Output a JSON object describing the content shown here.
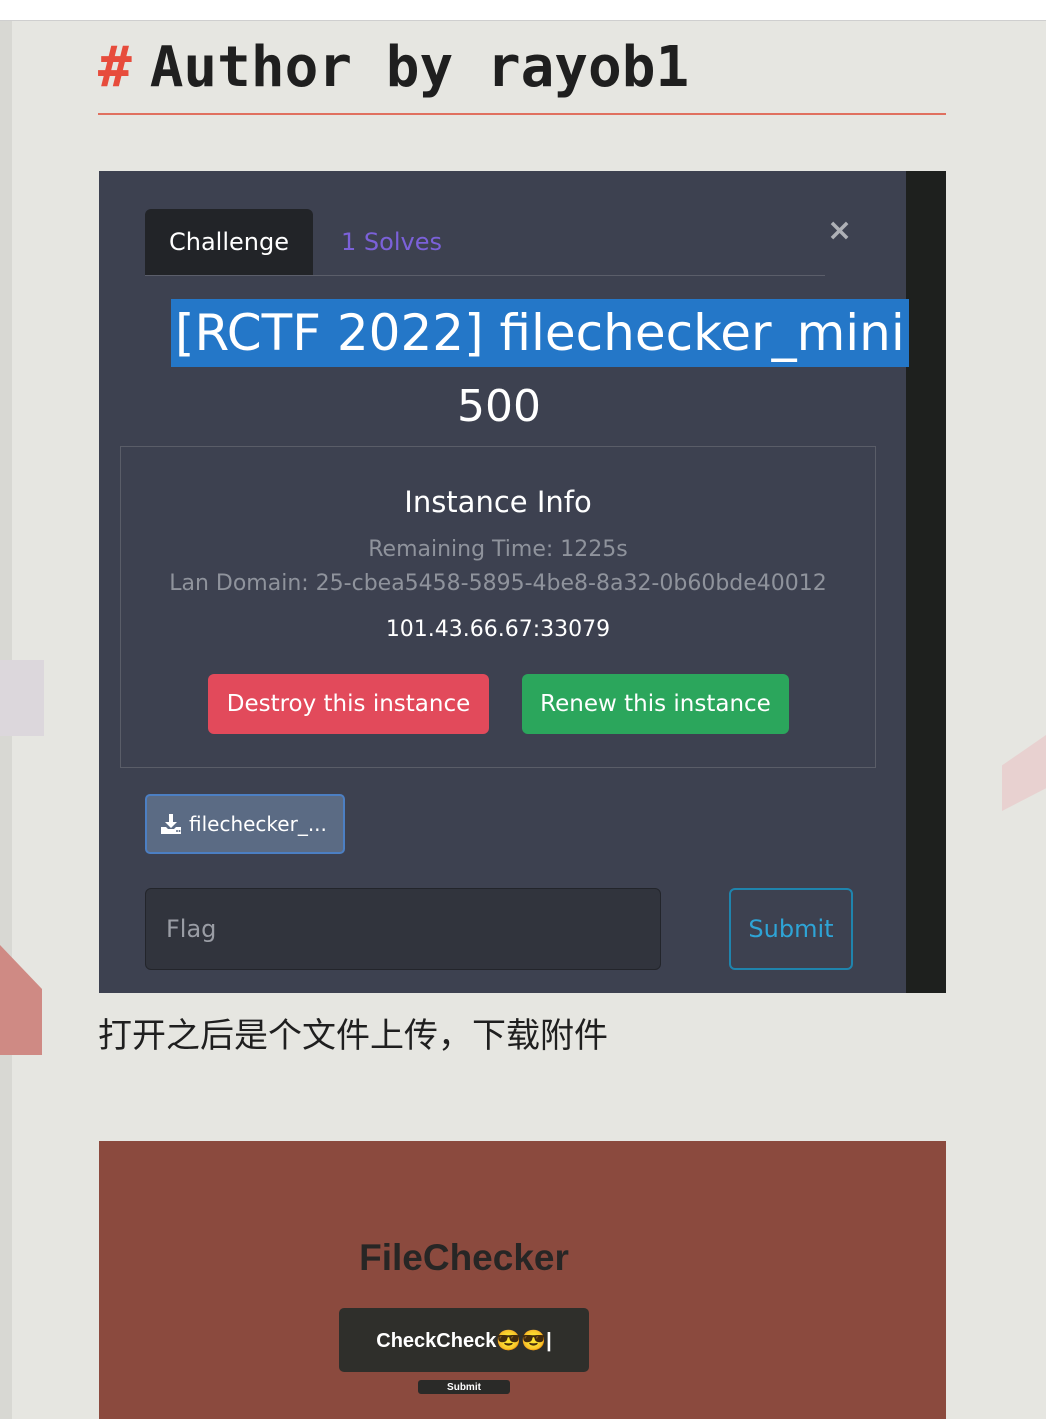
{
  "heading": {
    "hash": "#",
    "text": "Author by rayob1"
  },
  "challenge_modal": {
    "tabs": {
      "challenge": "Challenge",
      "solves": "1 Solves"
    },
    "close_symbol": "×",
    "title": "[RCTF 2022] filechecker_mini",
    "points": "500",
    "instance": {
      "title": "Instance Info",
      "remaining": "Remaining Time: 1225s",
      "lan_domain": "Lan Domain: 25-cbea5458-5895-4be8-8a32-0b60bde40012",
      "address": "101.43.66.67:33079",
      "destroy_label": "Destroy this instance",
      "renew_label": "Renew this instance"
    },
    "file_button": "filechecker_...",
    "flag_placeholder": "Flag",
    "submit_label": "Submit",
    "colors": {
      "selection": "#2477c8",
      "destroy": "#e24a5b",
      "renew": "#2ba65c",
      "solves": "#7b61d9"
    }
  },
  "caption": "打开之后是个文件上传，下载附件",
  "filechecker": {
    "title": "FileChecker",
    "input_value": "CheckCheck😎😎|",
    "submit_label": "Submit"
  },
  "icons": [
    "download-icon",
    "close-icon"
  ]
}
